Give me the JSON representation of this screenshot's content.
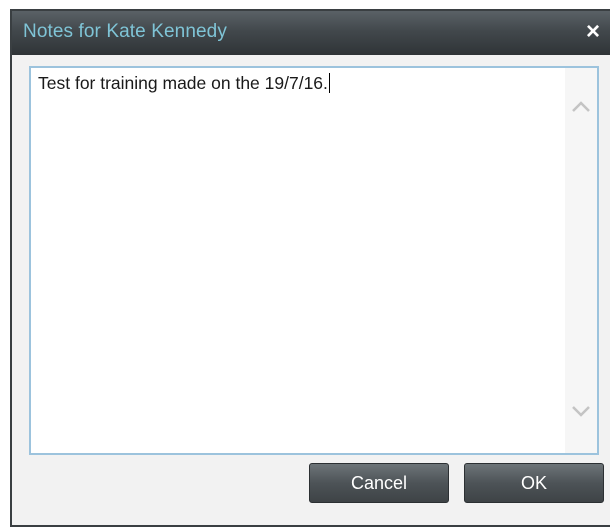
{
  "dialog": {
    "title": "Notes for Kate Kennedy",
    "close_label": "×"
  },
  "notes": {
    "value": "Test for training made on the 19/7/16."
  },
  "buttons": {
    "cancel_label": "Cancel",
    "ok_label": "OK"
  },
  "icons": {
    "close": "close-icon",
    "scroll_up": "chevron-up-icon",
    "scroll_down": "chevron-down-icon"
  },
  "colors": {
    "title_text": "#7fc4d6",
    "titlebar": "#42484c",
    "textarea_border": "#9cc3dd",
    "button": "#4d5357"
  }
}
